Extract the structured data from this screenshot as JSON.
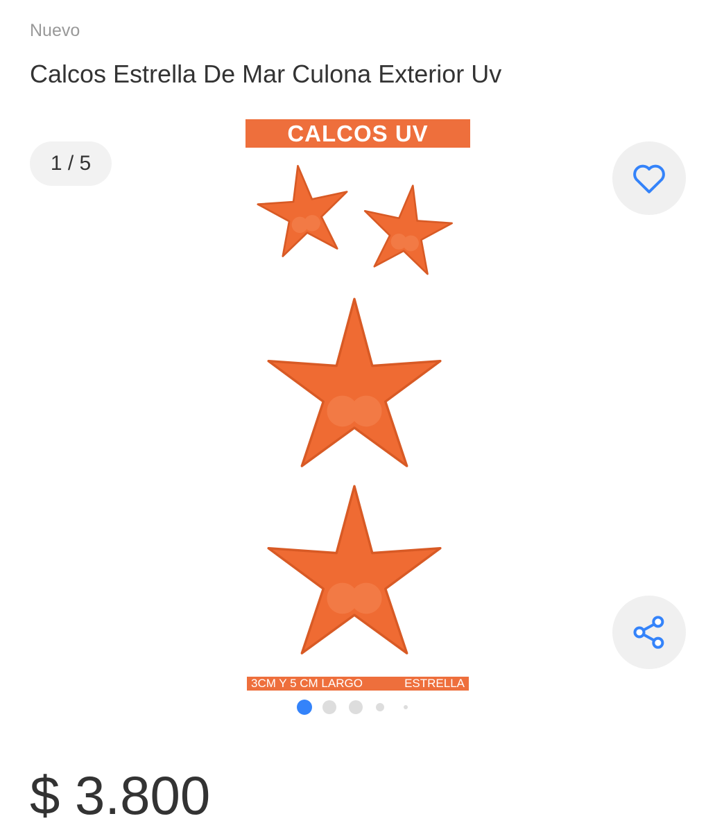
{
  "product": {
    "condition": "Nuevo",
    "title": "Calcos Estrella De Mar Culona Exterior Uv",
    "price": "$ 3.800"
  },
  "gallery": {
    "counter": "1 / 5",
    "current": 1,
    "total": 5,
    "image": {
      "banner_text": "CALCOS UV",
      "footer_left": "3CM Y 5 CM LARGO",
      "footer_right": "ESTRELLA",
      "accent_color": "#ee6f3c"
    }
  },
  "actions": {
    "favorite_icon": "heart-icon",
    "share_icon": "share-icon",
    "icon_color": "#3483fa"
  },
  "colors": {
    "dot_active": "#3483fa",
    "dot_inactive": "#dddddd"
  }
}
